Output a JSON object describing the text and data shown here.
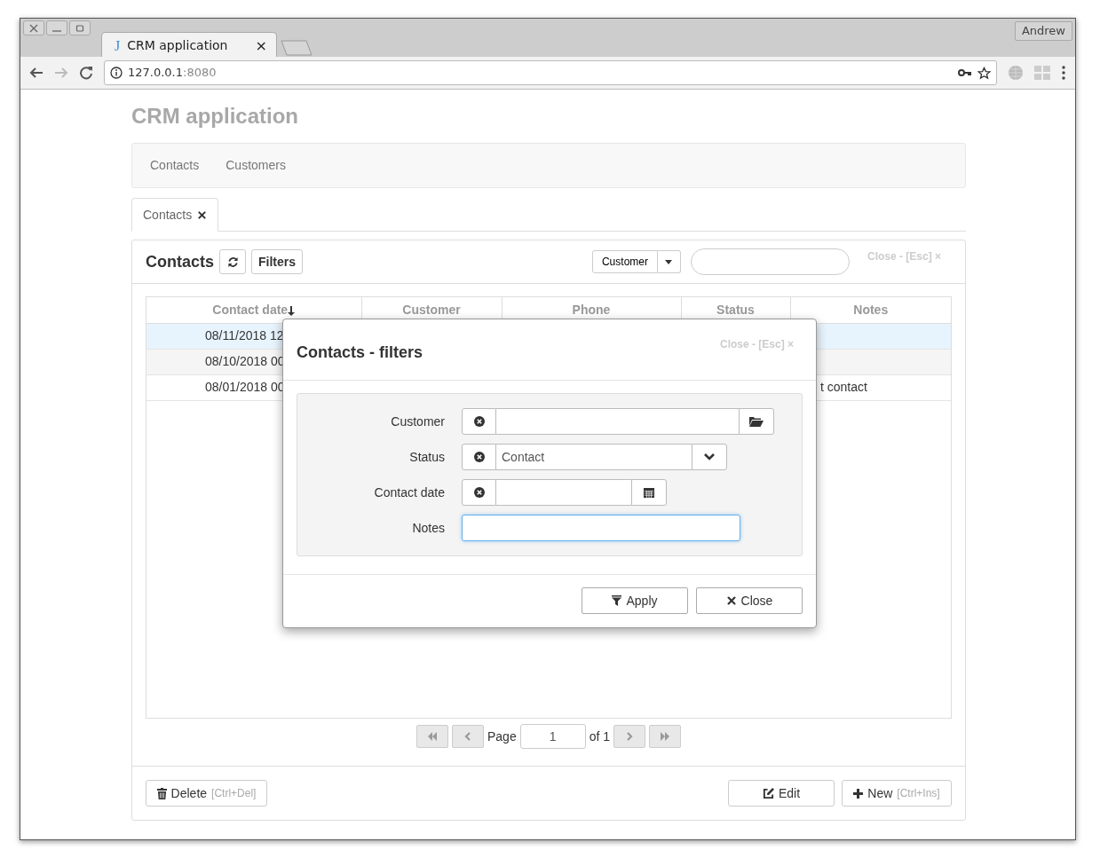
{
  "browser": {
    "tab": {
      "favicon": "J",
      "title": "CRM application",
      "close": "×",
      "selected": true
    },
    "profile": "Andrew",
    "url": {
      "host": "127.0.0.1",
      "port": ":8080"
    }
  },
  "app": {
    "title": "CRM application",
    "nav": [
      {
        "label": "Contacts",
        "selected": false
      },
      {
        "label": "Customers",
        "selected": false
      }
    ],
    "tabs": [
      {
        "label": "Contacts",
        "selected": true
      }
    ],
    "panel": {
      "title": "Contacts",
      "filters_button": "Filters",
      "search_scope": "Customer",
      "close_hint": "Close - [Esc] ×",
      "table": {
        "columns": [
          {
            "label": "Contact date",
            "sorted": true
          },
          {
            "label": "Customer",
            "sorted": false
          },
          {
            "label": "Phone",
            "sorted": false
          },
          {
            "label": "Status",
            "sorted": false
          },
          {
            "label": "Notes",
            "sorted": false
          }
        ],
        "rows": [
          {
            "selected": true,
            "contact_date": "08/11/2018 12"
          },
          {
            "selected": false,
            "contact_date": "08/10/2018 00"
          },
          {
            "selected": false,
            "contact_date": "08/01/2018 00",
            "notes": "t contact"
          }
        ]
      },
      "pagination": {
        "page_label": "Page",
        "page": "1",
        "of_label": "of 1"
      },
      "footer": {
        "delete": {
          "label": "Delete",
          "shortcut": "[Ctrl+Del]"
        },
        "edit": {
          "label": "Edit"
        },
        "new": {
          "label": "New",
          "shortcut": "[Ctrl+Ins]"
        }
      }
    },
    "modal": {
      "title": "Contacts - filters",
      "close_hint": "Close - [Esc] ×",
      "fields": [
        {
          "label": "Customer",
          "kind": "lookup"
        },
        {
          "label": "Status",
          "kind": "select",
          "value": "Contact"
        },
        {
          "label": "Contact date",
          "kind": "date"
        },
        {
          "label": "Notes",
          "kind": "text",
          "focused": true
        }
      ],
      "buttons": [
        {
          "label": "Apply",
          "kind": "apply"
        },
        {
          "label": "Close",
          "kind": "close"
        }
      ]
    }
  }
}
